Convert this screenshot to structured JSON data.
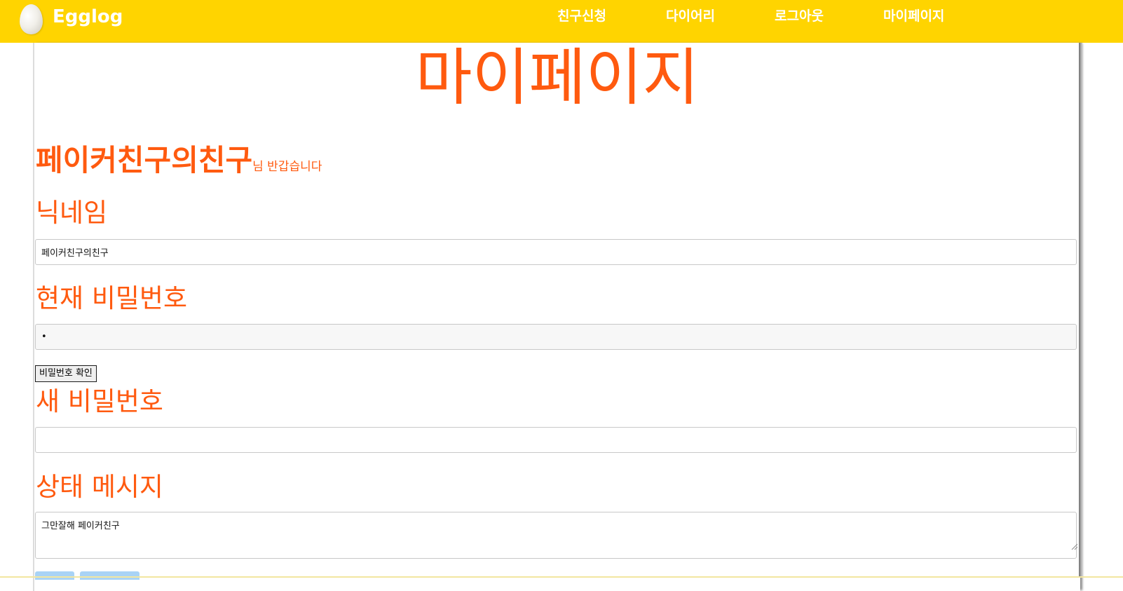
{
  "navbar": {
    "logo_text": "Egglog",
    "links": [
      "친구신청",
      "다이어리",
      "로그아웃",
      "마이페이지"
    ],
    "background_color": "#ffd400",
    "logo_icon": "egg-icon"
  },
  "page": {
    "title": "마이페이지",
    "accent_color": "#ff5a0f"
  },
  "greeting": {
    "name": "페이커친구의친구",
    "suffix": "님 반갑습니다"
  },
  "nickname": {
    "label": "닉네임",
    "value": "페이커친구의친구"
  },
  "current_password": {
    "label": "현재 비밀번호",
    "value": "•"
  },
  "confirm_button": {
    "label": "비밀번호 확인"
  },
  "new_password": {
    "label": "새 비밀번호",
    "value": ""
  },
  "status_message": {
    "label": "상태 메시지",
    "value": "그만잘해 페이커친구"
  }
}
